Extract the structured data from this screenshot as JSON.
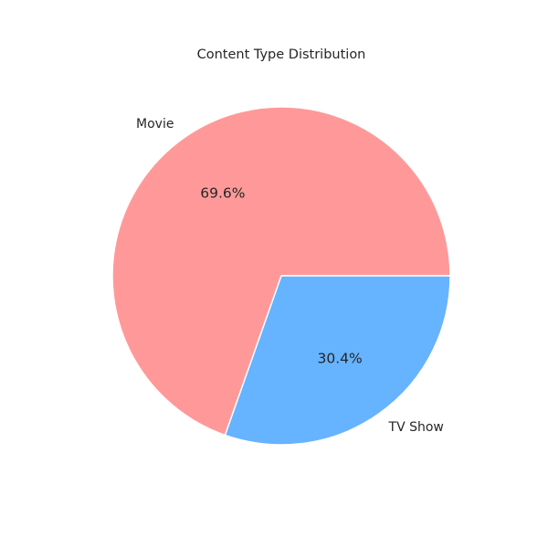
{
  "chart_data": {
    "type": "pie",
    "title": "Content Type Distribution",
    "slices": [
      {
        "label": "Movie",
        "value": 69.6,
        "pct_label": "69.6%",
        "color": "#ff9999"
      },
      {
        "label": "TV Show",
        "value": 30.4,
        "pct_label": "30.4%",
        "color": "#66b3ff"
      }
    ],
    "start_angle_deg": 0,
    "direction": "counterclockwise",
    "edge_color": "#ffffff",
    "legend": "none"
  }
}
